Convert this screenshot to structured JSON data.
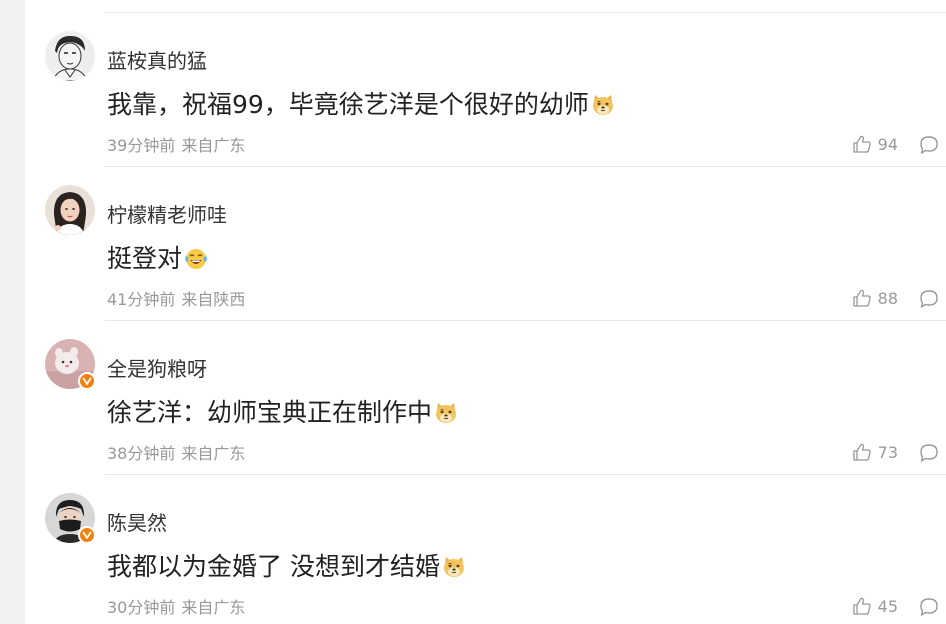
{
  "comments": [
    {
      "username": "蓝桉真的猛",
      "text": "我靠，祝福99，毕竟徐艺洋是个很好的幼师",
      "emoji": "doge-icon",
      "time": "39分钟前",
      "location": "来自广东",
      "likes": "94",
      "verified": false,
      "avatar": "sketch-portrait-avatar"
    },
    {
      "username": "柠檬精老师哇",
      "text": "挺登对",
      "emoji": "tears-of-joy-icon",
      "time": "41分钟前",
      "location": "来自陕西",
      "likes": "88",
      "verified": false,
      "avatar": "girl-photo-avatar"
    },
    {
      "username": "全是狗粮呀",
      "text": "徐艺洋：幼师宝典正在制作中",
      "emoji": "doge-icon",
      "time": "38分钟前",
      "location": "来自广东",
      "likes": "73",
      "verified": true,
      "avatar": "pink-cartoon-avatar"
    },
    {
      "username": "陈昊然",
      "text": "我都以为金婚了 没想到才结婚",
      "emoji": "doge-icon",
      "time": "30分钟前",
      "location": "来自广东",
      "likes": "45",
      "verified": true,
      "avatar": "masked-boy-avatar"
    }
  ],
  "colors": {
    "text_primary": "#222222",
    "username": "#333333",
    "meta": "#999999",
    "verified_badge": "#f4800c",
    "divider": "#e6e6e6"
  }
}
